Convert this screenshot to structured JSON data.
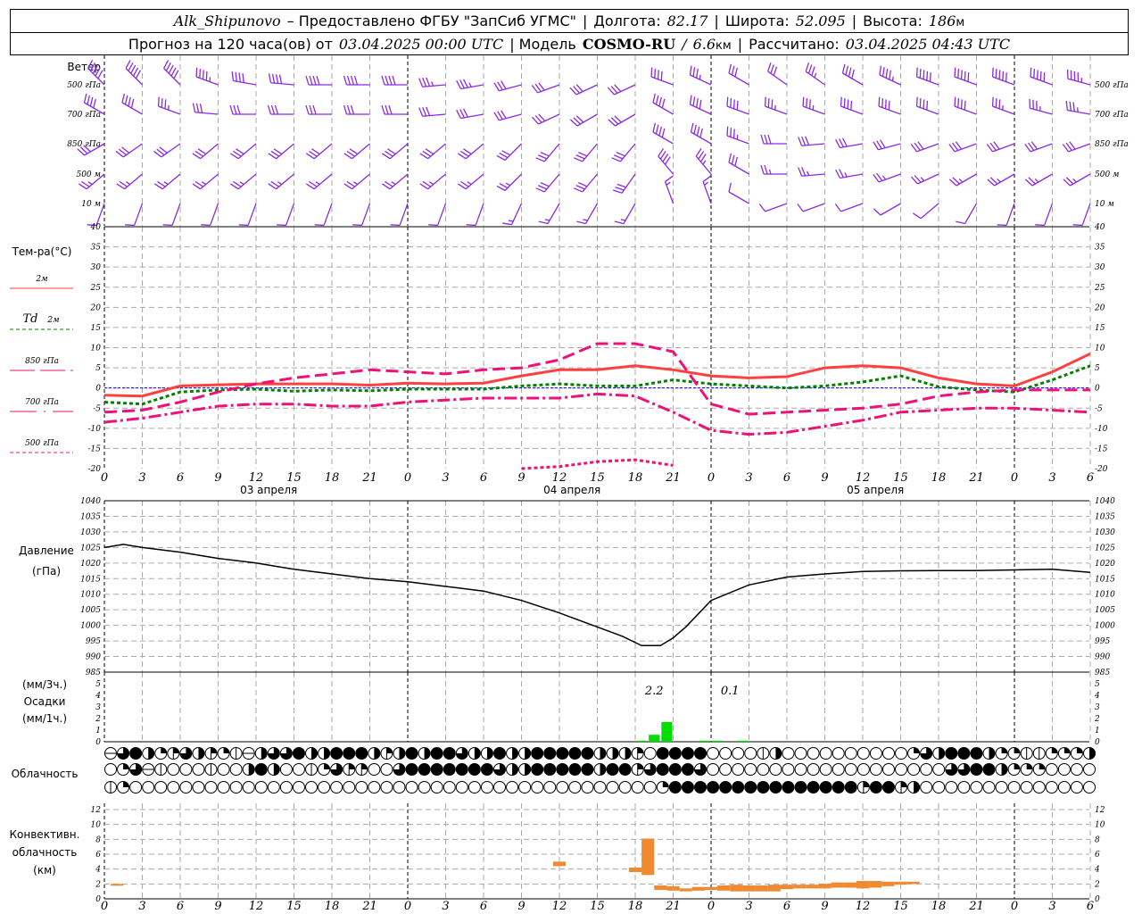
{
  "header": {
    "station": "Alk_Shipunovo",
    "provider": "– Предоставлено ФГБУ \"ЗапСиб УГМС\"",
    "sep": "|",
    "lon_label": "Долгота:",
    "lon": "82.17",
    "lat_label": "Широта:",
    "lat": "52.095",
    "alt_label": "Высота:",
    "alt": "186",
    "alt_unit": "м",
    "forecast_label": "Прогноз на 120 часа(ов) от",
    "forecast_start": "03.04.2025 00:00 UTC",
    "model_label": "| Модель",
    "model": "COSMO-RU",
    "slash": "/",
    "resolution": "6.6",
    "resolution_unit": "км",
    "computed_label": "Рассчитано:",
    "computed": "03.04.2025 04:43 UTC"
  },
  "x_axis": {
    "hours": [
      0,
      3,
      6,
      9,
      12,
      15,
      18,
      21,
      24,
      27,
      30,
      33,
      36,
      39,
      42,
      45,
      48,
      51,
      54,
      57,
      60,
      63,
      66,
      69,
      72,
      75,
      78
    ],
    "tick_labels": [
      "0",
      "3",
      "6",
      "9",
      "12",
      "15",
      "18",
      "21",
      "0",
      "3",
      "6",
      "9",
      "12",
      "15",
      "18",
      "21",
      "0",
      "3",
      "6",
      "9",
      "12",
      "15",
      "18",
      "21",
      "0",
      "3",
      "6"
    ],
    "day_labels": [
      {
        "text": "03 апреля",
        "hour": 13
      },
      {
        "text": "04 апреля",
        "hour": 37
      },
      {
        "text": "05 апреля",
        "hour": 61
      }
    ]
  },
  "chart_data": [
    {
      "type": "wind-barbs",
      "title": "Ветер",
      "units_note": "direction deg (from), speed m/s",
      "levels": [
        {
          "name": "500 гПа",
          "dir": [
            315,
            315,
            315,
            290,
            280,
            275,
            270,
            270,
            270,
            265,
            260,
            255,
            250,
            245,
            245,
            290,
            295,
            300,
            305,
            305,
            300,
            295,
            290,
            290,
            290,
            290,
            285
          ],
          "speed": [
            25,
            25,
            24,
            22,
            20,
            20,
            20,
            20,
            20,
            18,
            18,
            16,
            15,
            15,
            15,
            20,
            18,
            15,
            15,
            18,
            20,
            22,
            24,
            25,
            25,
            24,
            22
          ]
        },
        {
          "name": "700 гПа",
          "dir": [
            300,
            300,
            290,
            275,
            270,
            270,
            270,
            270,
            270,
            265,
            260,
            255,
            245,
            240,
            240,
            300,
            295,
            290,
            290,
            290,
            290,
            290,
            290,
            290,
            290,
            285,
            280
          ],
          "speed": [
            20,
            20,
            18,
            16,
            15,
            15,
            15,
            15,
            15,
            15,
            14,
            14,
            15,
            15,
            15,
            20,
            20,
            20,
            18,
            18,
            20,
            20,
            20,
            20,
            18,
            18,
            18
          ]
        },
        {
          "name": "850 гПа",
          "dir": [
            240,
            235,
            235,
            230,
            230,
            230,
            230,
            230,
            230,
            230,
            230,
            225,
            220,
            220,
            220,
            300,
            300,
            290,
            270,
            265,
            260,
            255,
            250,
            250,
            250,
            250,
            250
          ],
          "speed": [
            15,
            15,
            15,
            15,
            15,
            15,
            15,
            15,
            16,
            16,
            16,
            15,
            15,
            15,
            15,
            20,
            20,
            18,
            15,
            15,
            14,
            14,
            14,
            15,
            15,
            15,
            15
          ]
        },
        {
          "name": "500 м",
          "dir": [
            230,
            230,
            230,
            230,
            230,
            230,
            230,
            230,
            230,
            230,
            230,
            225,
            220,
            220,
            215,
            320,
            320,
            300,
            270,
            265,
            260,
            250,
            245,
            240,
            240,
            240,
            240
          ],
          "speed": [
            12,
            12,
            12,
            12,
            12,
            13,
            13,
            13,
            13,
            13,
            13,
            13,
            14,
            15,
            15,
            20,
            18,
            15,
            12,
            12,
            12,
            12,
            12,
            12,
            12,
            12,
            12
          ]
        },
        {
          "name": "10  м",
          "dir": [
            200,
            200,
            200,
            200,
            200,
            200,
            200,
            200,
            200,
            200,
            200,
            205,
            210,
            210,
            210,
            340,
            340,
            300,
            250,
            250,
            250,
            240,
            230,
            210,
            200,
            200,
            200
          ],
          "speed": [
            6,
            6,
            6,
            6,
            6,
            6,
            6,
            6,
            6,
            6,
            6,
            7,
            8,
            8,
            8,
            8,
            8,
            6,
            5,
            5,
            5,
            5,
            5,
            6,
            6,
            6,
            6
          ]
        }
      ]
    },
    {
      "type": "line",
      "ylabel": "Тем-ра(°C)",
      "ylim": [
        -20,
        40
      ],
      "y_ticks": [
        40,
        35,
        30,
        25,
        20,
        15,
        10,
        5,
        0,
        -5,
        -10,
        -15,
        -20
      ],
      "grid": true,
      "legend_placement": "left",
      "series": [
        {
          "name": "2м",
          "color": "#ff4040",
          "style": "solid",
          "values": [
            -1.8,
            -2,
            0.5,
            0.8,
            1,
            1,
            1,
            0.7,
            1.2,
            1,
            1.2,
            3,
            4.5,
            4.5,
            5.5,
            4.5,
            3,
            2.5,
            2.8,
            5,
            5.5,
            5,
            2.5,
            1,
            0.5,
            4,
            8.5
          ]
        },
        {
          "name_prefix": "Td",
          "name": "2м",
          "color": "#008000",
          "style": "dotted",
          "values": [
            -3.5,
            -4,
            -1,
            -0.5,
            -0.3,
            -0.8,
            -0.5,
            -0.7,
            -0.3,
            -0.3,
            -0.3,
            0.5,
            1,
            0.5,
            0.5,
            2,
            1,
            0.5,
            0,
            0.5,
            1.5,
            3,
            0.3,
            -0.5,
            -1,
            2,
            5.5
          ]
        },
        {
          "name": "850 гПа",
          "color": "#ee1177",
          "style": "dashed",
          "values": [
            -6,
            -5.5,
            -3.5,
            -1,
            1,
            2.5,
            3.5,
            4.5,
            4,
            3.5,
            4.5,
            5,
            7,
            11,
            11,
            9,
            -4,
            -6.5,
            -6,
            -5.5,
            -5,
            -4,
            -2,
            -1,
            -0.5,
            -0.5,
            -0.5
          ]
        },
        {
          "name": "700 гПа",
          "color": "#ee1177",
          "style": "dashdot",
          "values": [
            -8.5,
            -7.5,
            -6,
            -4.5,
            -4,
            -4,
            -4.5,
            -4.5,
            -3.5,
            -3,
            -2.5,
            -2.5,
            -2.5,
            -1.5,
            -2,
            -6,
            -10.5,
            -11.5,
            -11,
            -9.5,
            -8,
            -6,
            -5.5,
            -5,
            -5,
            -5.5,
            -6
          ]
        },
        {
          "name": "500 гПа",
          "color": "#ee1177",
          "style": "dotted",
          "values": [
            null,
            null,
            null,
            null,
            null,
            null,
            null,
            null,
            null,
            null,
            null,
            -20,
            -19.5,
            -18.3,
            -17.8,
            -19.2,
            null,
            null,
            null,
            null,
            null,
            null,
            null,
            null,
            null,
            null,
            null
          ]
        }
      ],
      "zero_line_color": "#0000ff"
    },
    {
      "type": "line",
      "ylabel": "Давление",
      "yunit": "(гПа)",
      "ylim": [
        985,
        1040
      ],
      "y_ticks": [
        1040,
        1035,
        1030,
        1025,
        1020,
        1015,
        1010,
        1005,
        1000,
        995,
        990,
        985
      ],
      "grid": true,
      "series": [
        {
          "color": "#000000",
          "x": [
            0,
            1.5,
            3,
            6,
            9,
            12,
            15,
            18,
            21,
            24,
            27,
            30,
            33,
            36,
            39,
            41,
            42.5,
            44,
            45,
            46,
            48,
            51,
            54,
            57,
            60,
            63,
            66,
            69,
            72,
            75,
            78
          ],
          "values": [
            1025,
            1026,
            1025,
            1023.5,
            1021.5,
            1020,
            1018,
            1016.5,
            1015,
            1014,
            1012.5,
            1011,
            1008,
            1004,
            999.5,
            996.5,
            993.5,
            993.5,
            996,
            999.5,
            1008,
            1013,
            1015.5,
            1016.5,
            1017.3,
            1017.5,
            1017.6,
            1017.6,
            1017.8,
            1018,
            1017
          ]
        }
      ]
    },
    {
      "type": "bar",
      "ylabel": "Осадки",
      "yunit_3h": "(мм/3ч.)",
      "yunit_1h": "(мм/1ч.)",
      "ylim": [
        0,
        5
      ],
      "y_ticks": [
        5,
        4,
        3,
        2,
        1,
        0
      ],
      "color": "#00dd00",
      "hourly": [
        {
          "hour": 42,
          "mm": 0.05
        },
        {
          "hour": 43,
          "mm": 0.6
        },
        {
          "hour": 44,
          "mm": 1.7
        },
        {
          "hour": 47,
          "mm": 0.05
        },
        {
          "hour": 48,
          "mm": 0.05
        },
        {
          "hour": 50,
          "mm": 0.05
        }
      ],
      "totals_3h": [
        {
          "hour": 43.5,
          "text": "2.2"
        },
        {
          "hour": 49.5,
          "text": "0.1"
        }
      ]
    },
    {
      "type": "symbols",
      "label": "Облачность",
      "encoding": "octas per hour, 0=clear, 1=line, 2=quarter, 3=quarter+line, 4=half, 6=three-quarter, 8=overcast, 9=obscured",
      "rows": [
        "9684236432194668448884348488644844888884443088880000140000000000264888422112224",
        "0269100010048400126330068888888644888884883688860000000000000000000668842220000",
        "1200000000000000000000000000000000000000000028888888888888883883400000000000000"
      ]
    },
    {
      "type": "range-bar",
      "ylabel": "Конвективн.",
      "ylabel2": "облачность",
      "yunit": "(км)",
      "ylim": [
        0,
        13
      ],
      "y_ticks": [
        12,
        10,
        8,
        6,
        4,
        2,
        0
      ],
      "color": "#f08a30",
      "bars": [
        {
          "hour": 1,
          "base": 1.8,
          "top": 2.0
        },
        {
          "hour": 36,
          "base": 4.4,
          "top": 5.0
        },
        {
          "hour": 42,
          "base": 3.6,
          "top": 4.2
        },
        {
          "hour": 43,
          "base": 3.2,
          "top": 8.1
        },
        {
          "hour": 44,
          "base": 1.2,
          "top": 1.8
        },
        {
          "hour": 45,
          "base": 1.1,
          "top": 1.7
        },
        {
          "hour": 46,
          "base": 1.0,
          "top": 1.4
        },
        {
          "hour": 47,
          "base": 1.1,
          "top": 1.6
        },
        {
          "hour": 48,
          "base": 1.2,
          "top": 1.6
        },
        {
          "hour": 49,
          "base": 1.1,
          "top": 1.8
        },
        {
          "hour": 50,
          "base": 1.0,
          "top": 1.9
        },
        {
          "hour": 51,
          "base": 1.0,
          "top": 1.8
        },
        {
          "hour": 52,
          "base": 1.0,
          "top": 1.8
        },
        {
          "hour": 53,
          "base": 1.0,
          "top": 1.9
        },
        {
          "hour": 54,
          "base": 1.3,
          "top": 1.9
        },
        {
          "hour": 55,
          "base": 1.4,
          "top": 1.9
        },
        {
          "hour": 56,
          "base": 1.4,
          "top": 1.9
        },
        {
          "hour": 57,
          "base": 1.4,
          "top": 2.0
        },
        {
          "hour": 58,
          "base": 1.5,
          "top": 2.2
        },
        {
          "hour": 59,
          "base": 1.5,
          "top": 2.2
        },
        {
          "hour": 60,
          "base": 1.4,
          "top": 2.4
        },
        {
          "hour": 61,
          "base": 1.5,
          "top": 2.4
        },
        {
          "hour": 62,
          "base": 1.7,
          "top": 2.3
        },
        {
          "hour": 63,
          "base": 1.9,
          "top": 2.3
        },
        {
          "hour": 64,
          "base": 2.0,
          "top": 2.3
        }
      ]
    }
  ]
}
